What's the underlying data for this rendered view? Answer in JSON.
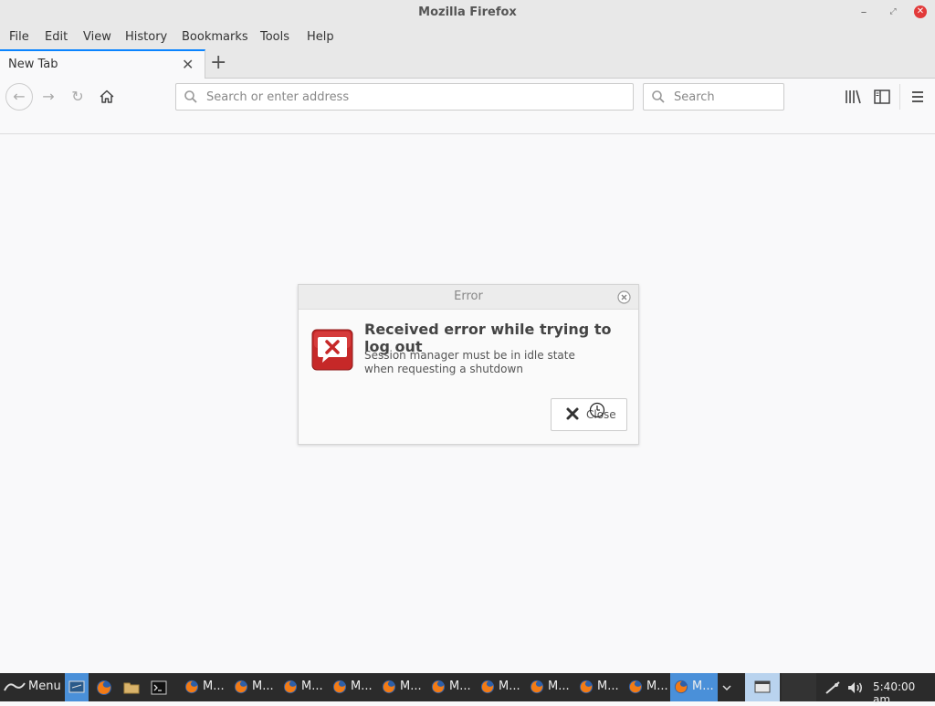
{
  "window": {
    "title": "Mozilla Firefox",
    "minimize": "–",
    "maximize": "⤢",
    "close": "✕"
  },
  "menubar": {
    "items": [
      "File",
      "Edit",
      "View",
      "History",
      "Bookmarks",
      "Tools",
      "Help"
    ]
  },
  "tabs": {
    "active_title": "New Tab",
    "close_glyph": "✕",
    "new_tab_glyph": "+"
  },
  "toolbar": {
    "back_glyph": "←",
    "forward_glyph": "→",
    "reload_glyph": "↻",
    "url_placeholder": "Search or enter address",
    "search_placeholder": "Search"
  },
  "dialog": {
    "title": "Error",
    "heading": "Received error while trying to log out",
    "message_line1": "Session manager must be in idle state",
    "message_line2": "when requesting a shutdown",
    "close_button_label": "Close",
    "accent_color": "#c62828"
  },
  "taskbar": {
    "menu_label": "Menu",
    "window_buttons": [
      "M...",
      "M...",
      "M...",
      "M...",
      "M...",
      "M...",
      "M...",
      "M...",
      "M...",
      "M...",
      "M..."
    ],
    "clock": "5:40:00 am",
    "active_color": "#4a90d9"
  }
}
